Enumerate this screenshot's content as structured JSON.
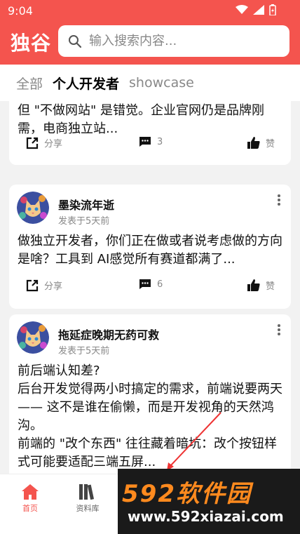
{
  "status_bar": {
    "time": "9:04"
  },
  "header": {
    "brand": "独谷",
    "search": {
      "placeholder": "输入搜索内容..."
    }
  },
  "tabs": [
    {
      "label": "全部",
      "active": false
    },
    {
      "label": "个人开发者",
      "active": true
    },
    {
      "label": "showcase",
      "active": false
    }
  ],
  "posts": [
    {
      "text": "但 \"不做网站\" 是错觉。企业官网仍是品牌刚需，电商独立站...",
      "share_label": "分享",
      "comments": "3",
      "like_label": "赞"
    },
    {
      "author": "墨染流年逝",
      "posted": "发表于5天前",
      "text": "做独立开发者，你们正在做或者说考虑做的方向是啥？工具到 AI感觉所有赛道都满了...",
      "share_label": "分享",
      "comments": "6",
      "like_label": "赞"
    },
    {
      "author": "拖延症晚期无药可救",
      "posted": "发表于5天前",
      "text_lines": [
        "前后端认知差?",
        "后台开发觉得两小时搞定的需求，前端说要两天 —— 这不是谁在偷懒，而是开发视角的天然鸿沟。",
        "前端的 \"改个东西\" 往往藏着暗坑：改个按钮样式可能要适配三端五屏..."
      ]
    }
  ],
  "bottom_nav": [
    {
      "label": "首页",
      "icon": "home-icon",
      "active": true
    },
    {
      "label": "资料库",
      "icon": "library-icon",
      "active": false
    }
  ],
  "watermark": {
    "brand": "592软件园",
    "url": "www.592xiazai.com"
  },
  "colors": {
    "accent": "#f4544e",
    "watermark_orange": "#ff8a1e"
  }
}
